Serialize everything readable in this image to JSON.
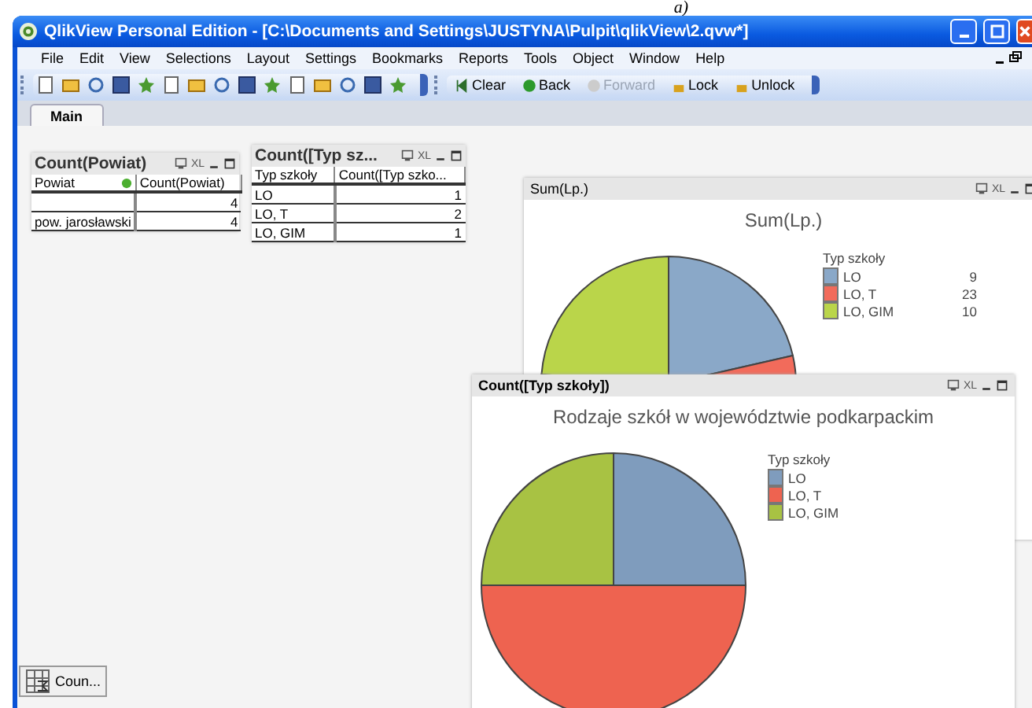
{
  "caption": "a)",
  "window": {
    "title": "QlikView Personal Edition - [C:\\Documents and Settings\\JUSTYNA\\Pulpit\\qlikView\\2.qvw*]"
  },
  "menu": [
    "File",
    "Edit",
    "View",
    "Selections",
    "Layout",
    "Settings",
    "Bookmarks",
    "Reports",
    "Tools",
    "Object",
    "Window",
    "Help"
  ],
  "toolbar_buttons": [
    {
      "label": "Clear",
      "kind": "clear",
      "disabled": false
    },
    {
      "label": "Back",
      "kind": "back",
      "disabled": false
    },
    {
      "label": "Forward",
      "kind": "forward",
      "disabled": true
    },
    {
      "label": "Lock",
      "kind": "lock",
      "disabled": false
    },
    {
      "label": "Unlock",
      "kind": "unlock",
      "disabled": false
    }
  ],
  "tabs": [
    {
      "label": "Main",
      "selected": true
    }
  ],
  "tables": [
    {
      "title": "Count(Powiat)",
      "export_label": "XL",
      "columns": [
        "Powiat",
        "Count(Powiat)"
      ],
      "rows": [
        [
          "",
          "4"
        ],
        [
          "pow. jarosławski",
          "4"
        ]
      ]
    },
    {
      "title": "Count([Typ sz...",
      "export_label": "XL",
      "columns": [
        "Typ szkoły",
        "Count([Typ szko..."
      ],
      "rows": [
        [
          "LO",
          "1"
        ],
        [
          "LO, T",
          "2"
        ],
        [
          "LO, GIM",
          "1"
        ]
      ]
    }
  ],
  "charts": [
    {
      "caption": "Sum(Lp.)",
      "export_label": "XL",
      "legend_title": "Typ szkoły",
      "slices": [
        {
          "color": "#8aa8c8"
        },
        {
          "color": "#f26b5b"
        },
        {
          "color": "#bad54a"
        }
      ],
      "chart_data": {
        "type": "pie",
        "title": "Sum(Lp.)",
        "categories": [
          "LO",
          "LO, T",
          "LO, GIM"
        ],
        "values": [
          9,
          23,
          10
        ],
        "data_labels": true,
        "legend": true
      }
    },
    {
      "caption": "Count([Typ szkoły])",
      "export_label": "XL",
      "legend_title": "Typ szkoły",
      "slices": [
        {
          "color": "#7f9cbd"
        },
        {
          "color": "#ee6350"
        },
        {
          "color": "#a8c243"
        }
      ],
      "chart_data": {
        "type": "pie",
        "title": "Rodzaje szkół w województwie podkarpackim",
        "categories": [
          "LO",
          "LO, T",
          "LO, GIM"
        ],
        "values": [
          25,
          50,
          25
        ],
        "legend": true
      }
    }
  ],
  "minimized": [
    {
      "label": "Coun..."
    }
  ]
}
